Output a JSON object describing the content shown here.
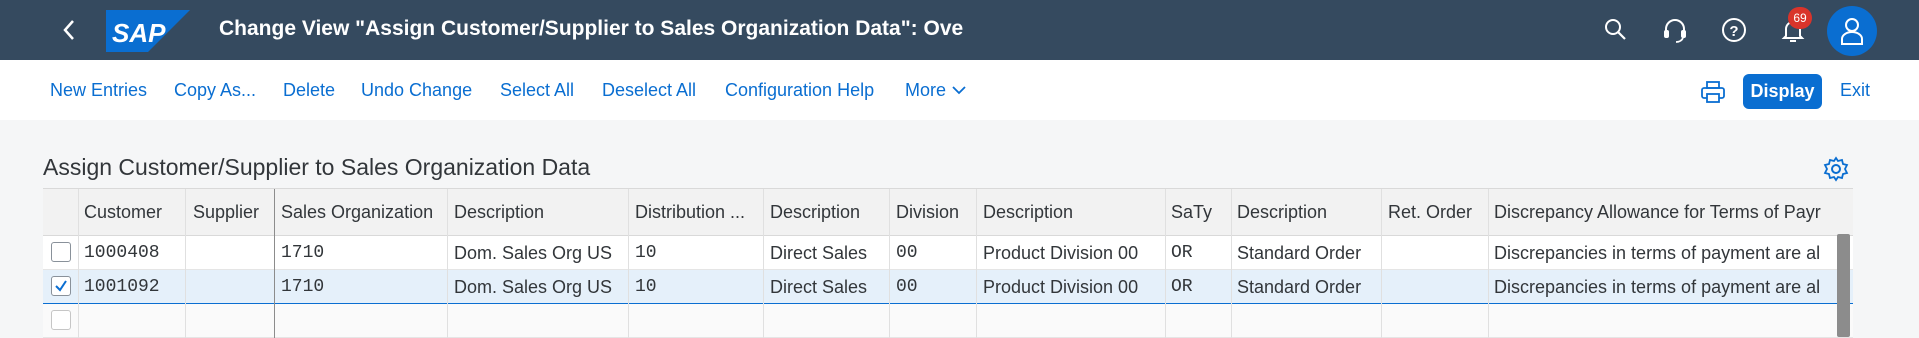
{
  "shell": {
    "title": "Change View \"Assign Customer/Supplier to Sales Organization Data\": Ove",
    "logo_text": "SAP",
    "notification_count": "69",
    "icons": [
      "back-icon",
      "search-icon",
      "headset-icon",
      "help-icon",
      "bell-icon",
      "user-icon"
    ]
  },
  "toolbar": {
    "new_entries": "New Entries",
    "copy_as": "Copy As...",
    "delete": "Delete",
    "undo_change": "Undo Change",
    "select_all": "Select All",
    "deselect_all": "Deselect All",
    "configuration_help": "Configuration Help",
    "more": "More",
    "display": "Display",
    "exit": "Exit"
  },
  "section": {
    "title": "Assign Customer/Supplier to Sales Organization Data"
  },
  "table": {
    "columns": [
      "Customer",
      "Supplier",
      "Sales Organization",
      "Description",
      "Distribution ...",
      "Description",
      "Division",
      "Description",
      "SaTy",
      "Description",
      "Ret. Order",
      "Discrepancy Allowance for Terms of Payr"
    ],
    "rows": [
      {
        "selected": false,
        "cells": [
          "1000408",
          "",
          "1710",
          "Dom. Sales Org US",
          "10",
          "Direct Sales",
          "00",
          "Product Division 00",
          "OR",
          "Standard Order",
          "",
          "Discrepancies in terms of payment are al"
        ]
      },
      {
        "selected": true,
        "cells": [
          "1001092",
          "",
          "1710",
          "Dom. Sales Org US",
          "10",
          "Direct Sales",
          "00",
          "Product Division 00",
          "OR",
          "Standard Order",
          "",
          "Discrepancies in terms of payment are al"
        ]
      }
    ]
  },
  "colors": {
    "shell": "#354a5f",
    "accent": "#0a6ed1",
    "badge": "#d9342b"
  }
}
